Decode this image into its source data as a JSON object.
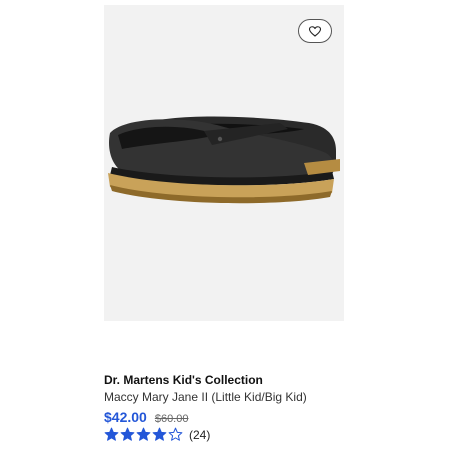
{
  "product": {
    "brand": "Dr. Martens Kid's Collection",
    "name": "Maccy Mary Jane II (Little Kid/Big Kid)",
    "price": "$42.00",
    "original_price": "$60.00",
    "rating": {
      "stars": 4,
      "max_stars": 5,
      "review_count": "(24)"
    }
  },
  "icons": {
    "favorite": "heart-outline-icon",
    "star_full": "star-filled-icon",
    "star_empty": "star-outline-icon"
  },
  "colors": {
    "price": "#2457d8",
    "stars": "#2457d8",
    "image_background": "#f2f2f2"
  }
}
